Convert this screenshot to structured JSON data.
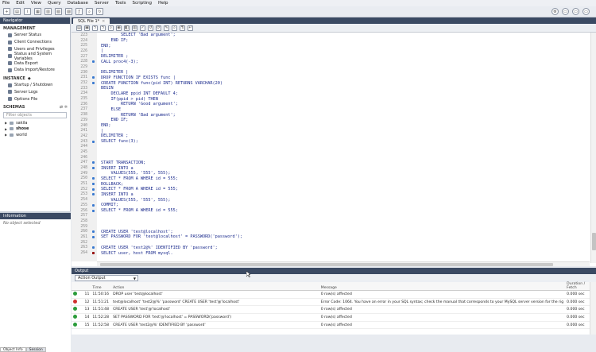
{
  "menu": [
    "File",
    "Edit",
    "View",
    "Query",
    "Database",
    "Server",
    "Tools",
    "Scripting",
    "Help"
  ],
  "navigator": {
    "title": "Navigator",
    "management_label": "MANAGEMENT",
    "management": [
      "Server Status",
      "Client Connections",
      "Users and Privileges",
      "Status and System Variables",
      "Data Export",
      "Data Import/Restore"
    ],
    "instance_label": "INSTANCE",
    "instance": [
      "Startup / Shutdown",
      "Server Logs",
      "Options File"
    ],
    "schemas_label": "SCHEMAS",
    "filter_placeholder": "Filter objects",
    "schemas": [
      "sakila",
      "shose",
      "world"
    ]
  },
  "information": {
    "title": "Information",
    "empty": "No object selected",
    "tabs": [
      "Object Info",
      "Session"
    ]
  },
  "editor": {
    "tab_label": "SQL File 1*",
    "lines": [
      {
        "n": "223",
        "mk": "",
        "t": "        SELECT 'Bad argument';"
      },
      {
        "n": "224",
        "mk": "",
        "t": "    END IF;"
      },
      {
        "n": "225",
        "mk": "",
        "t": "END;"
      },
      {
        "n": "226",
        "mk": "",
        "t": "|"
      },
      {
        "n": "227",
        "mk": "",
        "t": "DELIMITER ;"
      },
      {
        "n": "228",
        "mk": "dot",
        "t": "CALL proc4(-3);"
      },
      {
        "n": "229",
        "mk": "",
        "t": ""
      },
      {
        "n": "230",
        "mk": "",
        "t": "DELIMITER |"
      },
      {
        "n": "231",
        "mk": "dot",
        "t": "DROP FUNCTION IF EXISTS func |"
      },
      {
        "n": "232",
        "mk": "dot",
        "t": "CREATE FUNCTION func(pid INT) RETURNS VARCHAR(20)"
      },
      {
        "n": "233",
        "mk": "",
        "t": "BEGIN"
      },
      {
        "n": "234",
        "mk": "",
        "t": "    DECLARE ppid INT DEFAULT 4;"
      },
      {
        "n": "235",
        "mk": "",
        "t": "    IF(ppid > pid) THEN"
      },
      {
        "n": "236",
        "mk": "",
        "t": "        RETURN 'Good argument';"
      },
      {
        "n": "237",
        "mk": "",
        "t": "    ELSE"
      },
      {
        "n": "238",
        "mk": "",
        "t": "        RETURN 'Bad argument';"
      },
      {
        "n": "239",
        "mk": "",
        "t": "    END IF;"
      },
      {
        "n": "240",
        "mk": "",
        "t": "END;"
      },
      {
        "n": "241",
        "mk": "",
        "t": "|"
      },
      {
        "n": "242",
        "mk": "",
        "t": "DELIMITER ;"
      },
      {
        "n": "243",
        "mk": "dot",
        "t": "SELECT func(3);"
      },
      {
        "n": "244",
        "mk": "",
        "t": ""
      },
      {
        "n": "245",
        "mk": "",
        "t": ""
      },
      {
        "n": "246",
        "mk": "",
        "t": ""
      },
      {
        "n": "247",
        "mk": "dot",
        "t": "START TRANSACTION;"
      },
      {
        "n": "248",
        "mk": "dot",
        "t": "INSERT INTO a"
      },
      {
        "n": "249",
        "mk": "",
        "t": "    VALUES(555, '555', 555);"
      },
      {
        "n": "250",
        "mk": "dot",
        "t": "SELECT * FROM A WHERE id = 555;"
      },
      {
        "n": "251",
        "mk": "dot",
        "t": "ROLLBACK;"
      },
      {
        "n": "252",
        "mk": "dot",
        "t": "SELECT * FROM A WHERE id = 555;"
      },
      {
        "n": "253",
        "mk": "dot",
        "t": "INSERT INTO a"
      },
      {
        "n": "254",
        "mk": "",
        "t": "    VALUES(555, '555', 555);"
      },
      {
        "n": "255",
        "mk": "dot",
        "t": "COMMIT;"
      },
      {
        "n": "256",
        "mk": "dot",
        "t": "SELECT * FROM A WHERE id = 555;"
      },
      {
        "n": "257",
        "mk": "",
        "t": ""
      },
      {
        "n": "258",
        "mk": "",
        "t": ""
      },
      {
        "n": "259",
        "mk": "",
        "t": ""
      },
      {
        "n": "260",
        "mk": "dot",
        "t": "CREATE USER 'test@localhost';"
      },
      {
        "n": "261",
        "mk": "dot",
        "t": "SET PASSWORD FOR 'test@localhost' = PASSWORD('password');"
      },
      {
        "n": "262",
        "mk": "",
        "t": ""
      },
      {
        "n": "263",
        "mk": "dot",
        "t": "CREATE USER 'test2@%' IDENTIFIED BY 'password';"
      },
      {
        "n": "264",
        "mk": "err",
        "t": "SELECT user, host FROM mysql."
      }
    ]
  },
  "output": {
    "title": "Output",
    "mode": "Action Output",
    "columns": [
      "",
      "Time",
      "Action",
      "Message",
      "Duration / Fetch"
    ],
    "rows": [
      {
        "status": "ok",
        "num": "11",
        "time": "11:50:16",
        "action": "DROP user 'test@localhost'",
        "message": "0 row(s) affected",
        "dur": "0.000 sec"
      },
      {
        "status": "err",
        "num": "12",
        "time": "11:51:21",
        "action": "test@localhost' 'test2@%' 'password' CREATE USER 'test'@'localhost'",
        "message": "Error Code: 1064. You have an error in your SQL syntax; check the manual that corresponds to your MySQL server version for the rig",
        "dur": "0.000 sec"
      },
      {
        "status": "ok",
        "num": "13",
        "time": "11:51:48",
        "action": "CREATE USER 'test'@'localhost'",
        "message": "0 row(s) affected",
        "dur": "0.000 sec"
      },
      {
        "status": "ok",
        "num": "14",
        "time": "11:52:28",
        "action": "SET PASSWORD FOR 'test'@'localhost' = PASSWORD('password')",
        "message": "0 row(s) affected",
        "dur": "0.000 sec"
      },
      {
        "status": "ok",
        "num": "15",
        "time": "11:52:58",
        "action": "CREATE USER 'test2@%' IDENTIFIED BY 'password'",
        "message": "0 row(s) affected",
        "dur": "0.000 sec"
      }
    ]
  }
}
